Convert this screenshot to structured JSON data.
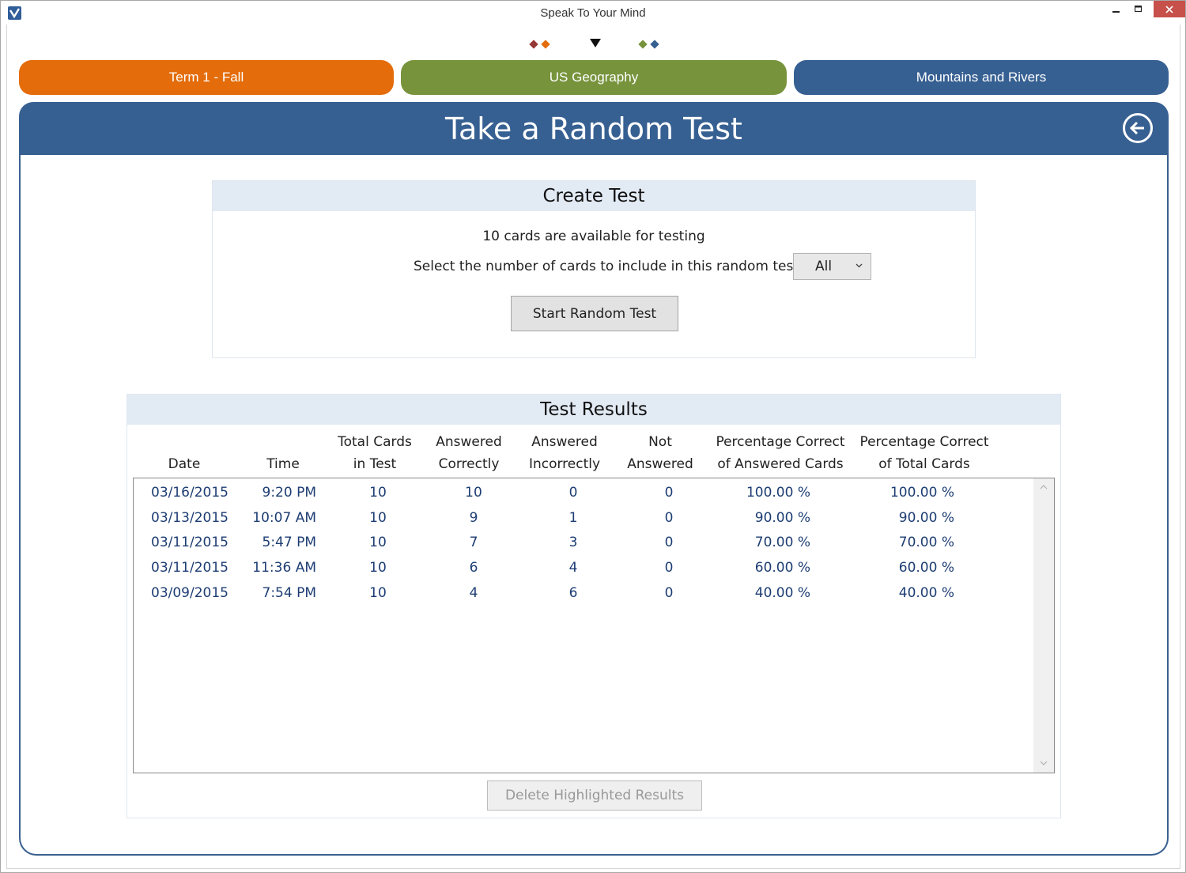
{
  "window": {
    "title": "Speak To Your Mind",
    "min_symbol": "—",
    "max_symbol": "☐",
    "close_symbol": "✕"
  },
  "colors": {
    "orange": "#e46c0a",
    "green": "#77933c",
    "blue": "#376092",
    "dark_red": "#953735"
  },
  "tabs": [
    {
      "label": "Term 1 - Fall"
    },
    {
      "label": "US Geography"
    },
    {
      "label": "Mountains and Rivers"
    }
  ],
  "header": {
    "title": "Take a Random Test",
    "back_icon": "arrow-left-circle-icon"
  },
  "create_test": {
    "title": "Create Test",
    "available_text": "10 cards are available for testing",
    "select_label": "Select the number of cards to include in this random test",
    "select_value": "All",
    "start_button": "Start Random Test"
  },
  "results": {
    "title": "Test Results",
    "columns": [
      "Date",
      "Time",
      "Total Cards\nin Test",
      "Answered\nCorrectly",
      "Answered\nIncorrectly",
      "Not\nAnswered",
      "Percentage Correct\nof Answered Cards",
      "Percentage Correct\nof Total Cards"
    ],
    "rows": [
      [
        "03/16/2015",
        "9:20 PM",
        "10",
        "10",
        "0",
        "0",
        "100.00 %",
        "100.00 %"
      ],
      [
        "03/13/2015",
        "10:07 AM",
        "10",
        "9",
        "1",
        "0",
        "90.00 %",
        "90.00 %"
      ],
      [
        "03/11/2015",
        "5:47 PM",
        "10",
        "7",
        "3",
        "0",
        "70.00 %",
        "70.00 %"
      ],
      [
        "03/11/2015",
        "11:36 AM",
        "10",
        "6",
        "4",
        "0",
        "60.00 %",
        "60.00 %"
      ],
      [
        "03/09/2015",
        "7:54 PM",
        "10",
        "4",
        "6",
        "0",
        "40.00 %",
        "40.00 %"
      ]
    ],
    "delete_button": "Delete Highlighted Results"
  }
}
